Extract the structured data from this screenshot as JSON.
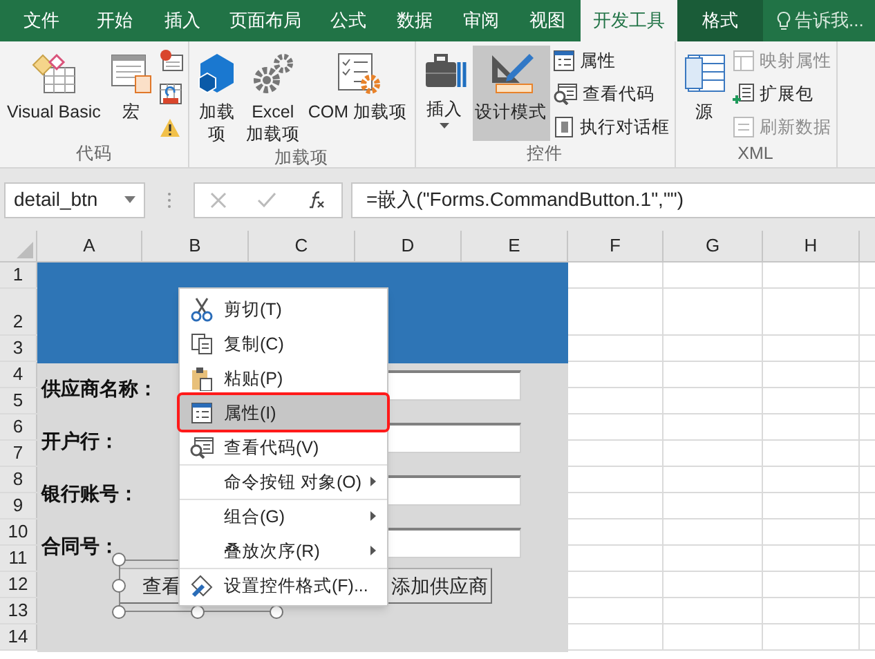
{
  "tabs": [
    {
      "label": "文件",
      "selected": false,
      "kind": "normal"
    },
    {
      "label": "开始",
      "selected": false,
      "kind": "normal"
    },
    {
      "label": "插入",
      "selected": false,
      "kind": "normal"
    },
    {
      "label": "页面布局",
      "selected": false,
      "kind": "normal"
    },
    {
      "label": "公式",
      "selected": false,
      "kind": "normal"
    },
    {
      "label": "数据",
      "selected": false,
      "kind": "normal"
    },
    {
      "label": "审阅",
      "selected": false,
      "kind": "normal"
    },
    {
      "label": "视图",
      "selected": false,
      "kind": "normal"
    },
    {
      "label": "开发工具",
      "selected": true,
      "kind": "normal"
    },
    {
      "label": "格式",
      "selected": false,
      "kind": "contextual"
    }
  ],
  "tell_me": "告诉我...",
  "ribbon_groups": [
    {
      "label": "代码",
      "buttons": [
        {
          "kind": "large",
          "label": "Visual Basic"
        },
        {
          "kind": "large",
          "label": "宏"
        },
        {
          "kind": "stack",
          "items": [
            {
              "kind": "icon"
            },
            {
              "kind": "icon"
            },
            {
              "kind": "icon"
            }
          ]
        }
      ]
    },
    {
      "label": "加载项",
      "buttons": [
        {
          "kind": "narrow",
          "label": "加载项"
        },
        {
          "kind": "large",
          "label": "Excel\n加载项"
        },
        {
          "kind": "large",
          "label": "COM 加载项"
        }
      ]
    },
    {
      "label": "控件",
      "buttons": [
        {
          "kind": "large",
          "label": "插入",
          "dropdown": true
        },
        {
          "kind": "large",
          "label": "设计模式",
          "selected": true
        },
        {
          "kind": "stack",
          "items": [
            {
              "kind": "labeled",
              "label": "属性",
              "disabled": false
            },
            {
              "kind": "labeled",
              "label": "查看代码",
              "disabled": false
            },
            {
              "kind": "labeled",
              "label": "执行对话框",
              "disabled": false
            }
          ]
        }
      ]
    },
    {
      "label": "XML",
      "buttons": [
        {
          "kind": "large",
          "label": "源"
        },
        {
          "kind": "stack",
          "items": [
            {
              "kind": "labeled",
              "label": "映射属性",
              "disabled": true
            },
            {
              "kind": "labeled",
              "label": "扩展包",
              "disabled": false
            },
            {
              "kind": "labeled",
              "label": "刷新数据",
              "disabled": true
            }
          ]
        }
      ]
    }
  ],
  "name_box": "detail_btn",
  "formula": "=嵌入(\"Forms.CommandButton.1\",\"\")",
  "columns": [
    "A",
    "B",
    "C",
    "D",
    "E",
    "F",
    "G",
    "H"
  ],
  "rows": [
    "1",
    "2",
    "3",
    "4",
    "5",
    "6",
    "7",
    "8",
    "9",
    "10",
    "11",
    "12",
    "13",
    "14"
  ],
  "form": {
    "labels": [
      "供应商名称：",
      "开户行：",
      "银行账号：",
      "合同号："
    ],
    "buttons": [
      {
        "label": "查看",
        "selected": true
      },
      {
        "label": "添加供应商",
        "selected": false
      }
    ]
  },
  "context_menu": [
    {
      "label": "剪切(T)",
      "kind": "item",
      "highlighted": false,
      "separator_before": false
    },
    {
      "label": "复制(C)",
      "kind": "item",
      "highlighted": false,
      "separator_before": false
    },
    {
      "label": "粘贴(P)",
      "kind": "item",
      "highlighted": false,
      "separator_before": false
    },
    {
      "label": "属性(I)",
      "kind": "item",
      "highlighted": true,
      "separator_before": false
    },
    {
      "label": "查看代码(V)",
      "kind": "item",
      "highlighted": false,
      "separator_before": false
    },
    {
      "label": "命令按钮 对象(O)",
      "kind": "submenu",
      "highlighted": false,
      "separator_before": true
    },
    {
      "label": "组合(G)",
      "kind": "submenu",
      "highlighted": false,
      "separator_before": true
    },
    {
      "label": "叠放次序(R)",
      "kind": "submenu",
      "highlighted": false,
      "separator_before": false
    },
    {
      "label": "设置控件格式(F)...",
      "kind": "item",
      "highlighted": false,
      "separator_before": true
    }
  ]
}
